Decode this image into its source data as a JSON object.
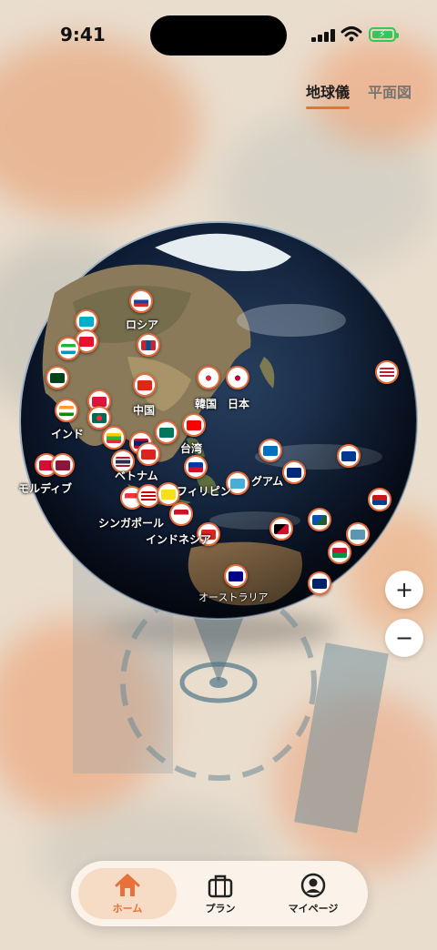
{
  "status": {
    "time": "9:41"
  },
  "view_tabs": [
    {
      "label": "地球儀",
      "active": true
    },
    {
      "label": "平面図",
      "active": false
    }
  ],
  "map_labels": {
    "russia": "ロシア",
    "china": "中国",
    "korea": "韓国",
    "japan": "日本",
    "india": "インド",
    "taiwan": "台湾",
    "vietnam": "ベトナム",
    "maldives": "モルディブ",
    "philippines": "フィリピン",
    "guam": "グアム",
    "singapore": "シンガポール",
    "indonesia": "インドネシア",
    "australia": "オーストラリア"
  },
  "zoom": {
    "in": "+",
    "out": "−"
  },
  "nav": [
    {
      "label": "ホーム",
      "icon": "home-icon",
      "active": true
    },
    {
      "label": "プラン",
      "icon": "suitcase-icon",
      "active": false
    },
    {
      "label": "マイページ",
      "icon": "user-icon",
      "active": false
    }
  ],
  "colors": {
    "accent": "#e8703a",
    "pin_border": "#e26c3c",
    "ocean": "#0e1a30"
  }
}
